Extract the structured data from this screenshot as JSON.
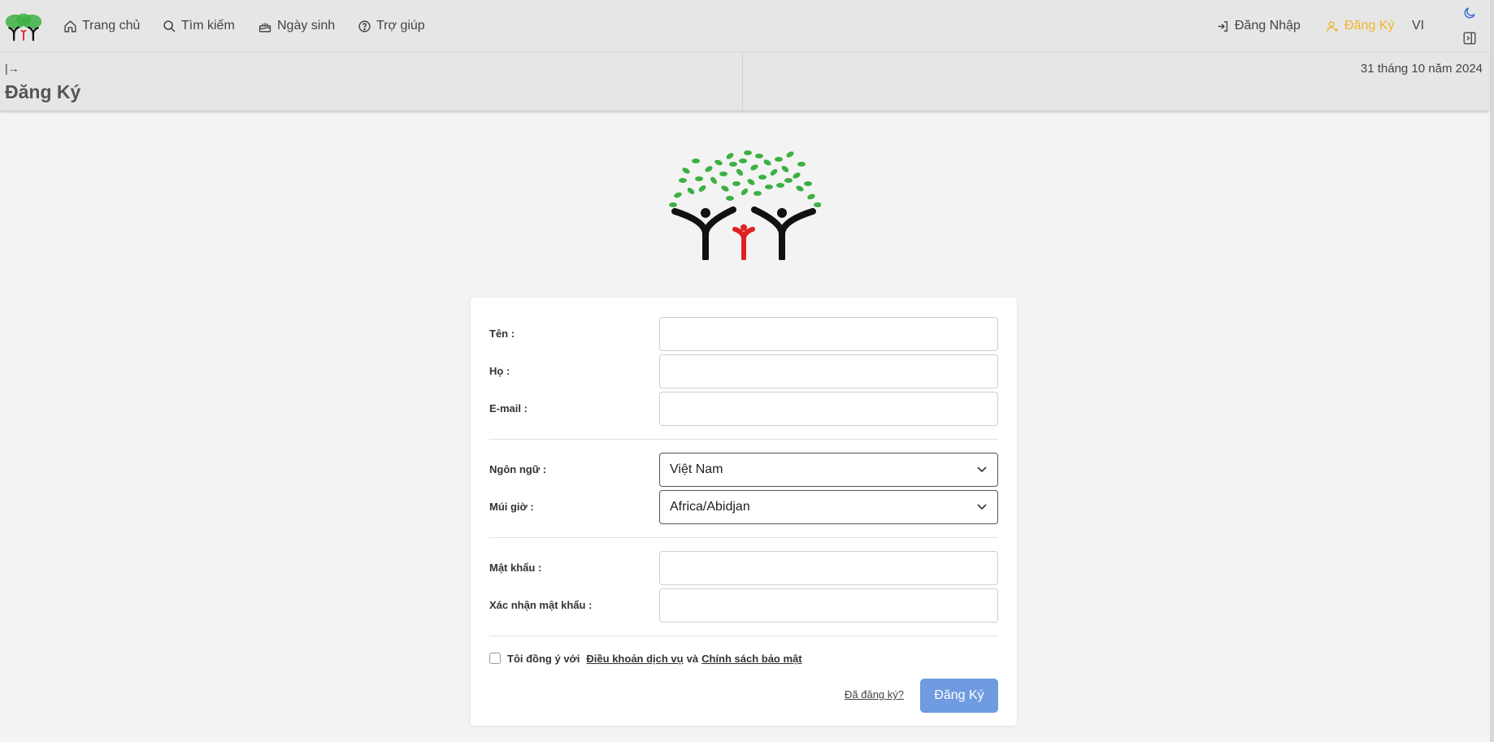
{
  "nav": {
    "home_label": "Trang chủ",
    "search_label": "Tìm kiếm",
    "birthday_label": "Ngày sinh",
    "help_label": "Trợ giúp",
    "login_label": "Đăng Nhập",
    "register_label": "Đăng Ký",
    "language_code": "VI",
    "icons": [
      "home-icon",
      "search-icon",
      "cake-icon",
      "help-icon",
      "login-icon",
      "user-plus-icon",
      "moon-icon",
      "sidebar-toggle-icon"
    ]
  },
  "subheader": {
    "collapse_glyph": "|→",
    "title": "Đăng Ký",
    "date": "31 tháng 10 năm 2024"
  },
  "form": {
    "first_name_label": "Tên :",
    "first_name_value": "",
    "last_name_label": "Họ :",
    "last_name_value": "",
    "email_label": "E-mail :",
    "email_value": "",
    "language_label": "Ngôn ngữ :",
    "language_value": "Việt Nam",
    "timezone_label": "Múi giờ :",
    "timezone_value": "Africa/Abidjan",
    "password_label": "Mật khẩu :",
    "password_value": "",
    "confirm_password_label": "Xác nhận mật khẩu :",
    "confirm_password_value": "",
    "terms_prefix": "Tôi đồng ý với",
    "terms_link": "Điều khoản dịch vụ",
    "terms_and": "và",
    "privacy_link": "Chính sách bảo mật",
    "terms_checked": false,
    "already_registered": "Đã đăng ký?",
    "submit_label": "Đăng Ký"
  },
  "colors": {
    "accent": "#f0b429",
    "button": "#6f9be0",
    "leaf_green": "#3cb043",
    "figure_red": "#e02020"
  }
}
